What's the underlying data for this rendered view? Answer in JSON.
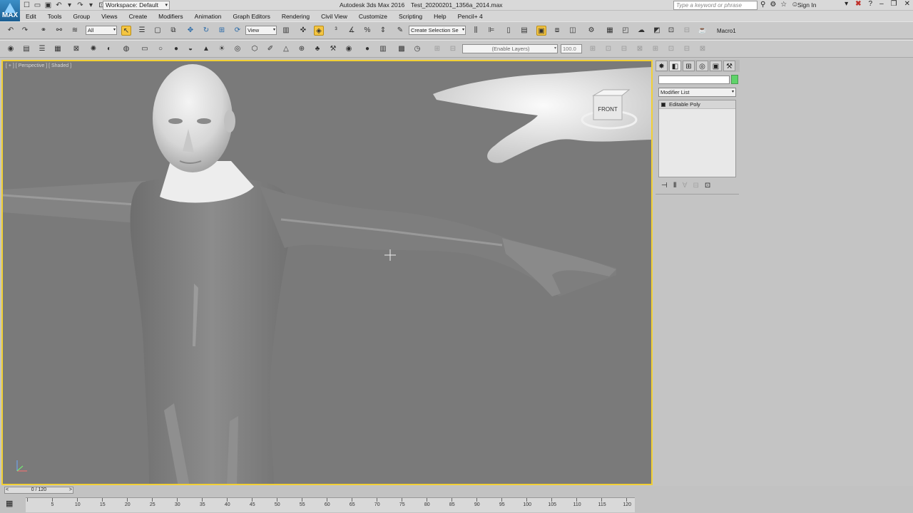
{
  "title": {
    "app": "Autodesk 3ds Max 2016",
    "file": "Test_20200201_1356a_2014.max",
    "workspace": "Workspace: Default",
    "search_placeholder": "Type a keyword or phrase",
    "signin": "Sign In",
    "logo_text": "MAX"
  },
  "menu": [
    "Edit",
    "Tools",
    "Group",
    "Views",
    "Create",
    "Modifiers",
    "Animation",
    "Graph Editors",
    "Rendering",
    "Civil View",
    "Customize",
    "Scripting",
    "Help",
    "Pencil+ 4"
  ],
  "toolbar1": {
    "selection_filter": "All",
    "ref_coord": "View",
    "named_selection": "Create Selection Se",
    "macro": "Macro1"
  },
  "toolbar2": {
    "layer_dropdown": "(Enable Layers)",
    "zoom_value": "100.0"
  },
  "viewport": {
    "label": "[ + ] [ Perspective ] [ Shaded ]",
    "viewcube_label": "FRONT",
    "accent_color": "#f2d034"
  },
  "command_panel": {
    "modifier_list": "Modifier List",
    "stack_items": [
      "Editable Poly"
    ],
    "object_color": "#5fd36a"
  },
  "timeline": {
    "frame_display": "0 / 120",
    "ticks": [
      0,
      5,
      10,
      15,
      20,
      25,
      30,
      35,
      40,
      45,
      50,
      55,
      60,
      65,
      70,
      75,
      80,
      85,
      90,
      95,
      100,
      105,
      110,
      115,
      120
    ]
  }
}
